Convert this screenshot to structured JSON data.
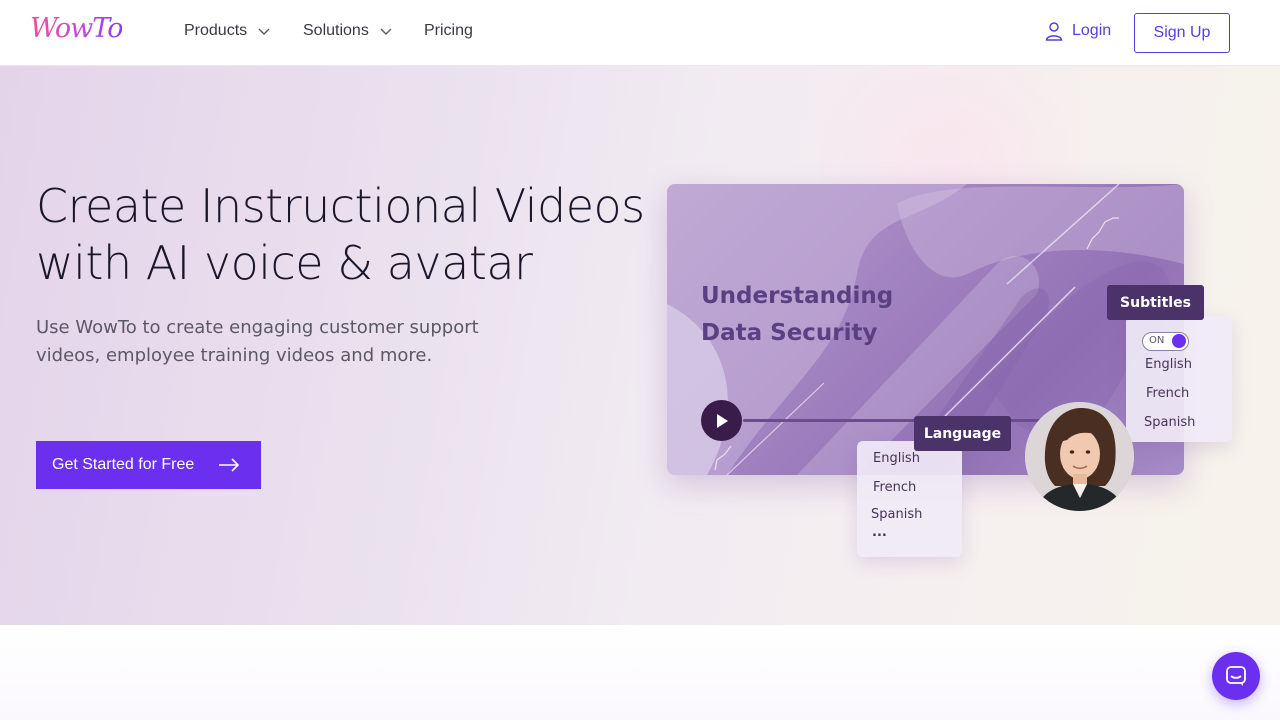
{
  "brand": {
    "name": "WowTo",
    "colors": {
      "accent": "#6b2ff0",
      "logo_pink": "#ef4f96",
      "logo_purple": "#8b3ff0"
    }
  },
  "nav": {
    "items": [
      {
        "label": "Products",
        "icon": "chevron-down-icon"
      },
      {
        "label": "Solutions",
        "icon": "chevron-down-icon"
      },
      {
        "label": "Pricing"
      }
    ],
    "login_label": "Login",
    "signup_label": "Sign Up"
  },
  "hero": {
    "title_line1": "Create Instructional Videos",
    "title_line2": "with AI voice & avatar",
    "subtitle_line1": "Use WowTo to create engaging customer support",
    "subtitle_line2": "videos, employee training videos and more.",
    "cta_label": "Get Started for Free"
  },
  "video_card": {
    "title_line1": "Understanding",
    "title_line2": "Data Security",
    "subtitles_badge": "Subtitles",
    "toggle_label": "ON",
    "subtitle_options": [
      "English",
      "French",
      "Spanish"
    ],
    "language_badge": "Language",
    "language_options": [
      "English",
      "French",
      "Spanish",
      "..."
    ]
  },
  "chat": {
    "icon": "chat-icon"
  }
}
